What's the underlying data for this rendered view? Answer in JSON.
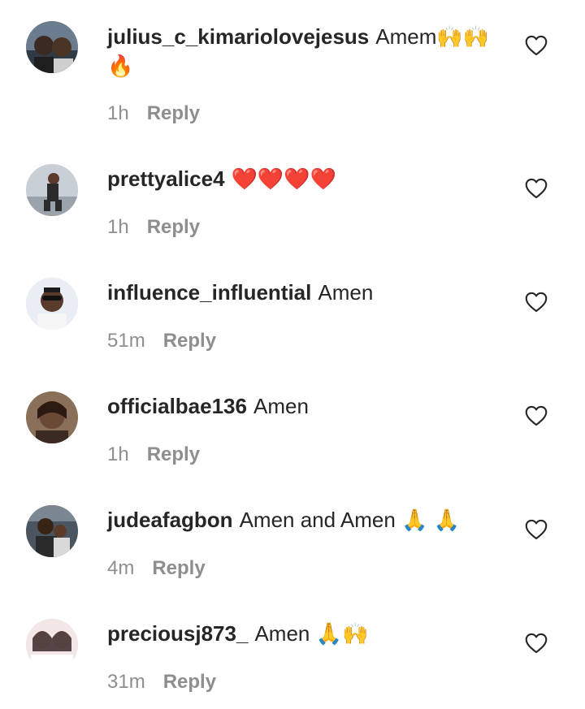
{
  "comments": [
    {
      "username": "julius_c_kimariolovejesus",
      "text": "Amem🙌🙌 🔥",
      "time": "1h",
      "reply_label": "Reply",
      "avatar_colors": [
        "#6b7c8f",
        "#3b2a22"
      ]
    },
    {
      "username": "prettyalice4",
      "text": "❤️❤️❤️❤️",
      "time": "1h",
      "reply_label": "Reply",
      "avatar_colors": [
        "#c9cfd6",
        "#2b2b2b"
      ]
    },
    {
      "username": "influence_influential",
      "text": "Amen",
      "time": "51m",
      "reply_label": "Reply",
      "avatar_colors": [
        "#e8eef3",
        "#5a3a2a"
      ]
    },
    {
      "username": "officialbae136",
      "text": "Amen",
      "time": "1h",
      "reply_label": "Reply",
      "avatar_colors": [
        "#8a6f5a",
        "#2a1a12"
      ]
    },
    {
      "username": "judeafagbon",
      "text": "Amen and Amen 🙏 🙏",
      "time": "4m",
      "reply_label": "Reply",
      "avatar_colors": [
        "#4a5560",
        "#d9d9d9"
      ]
    },
    {
      "username": "preciousj873_",
      "text": "Amen 🙏🙌",
      "time": "31m",
      "reply_label": "Reply",
      "avatar_colors": [
        "#f2e6e6",
        "#3a2a2a"
      ]
    }
  ],
  "icons": {
    "like": "heart-outline-icon"
  },
  "colors": {
    "text": "#262626",
    "secondary": "#8e8e8e"
  }
}
